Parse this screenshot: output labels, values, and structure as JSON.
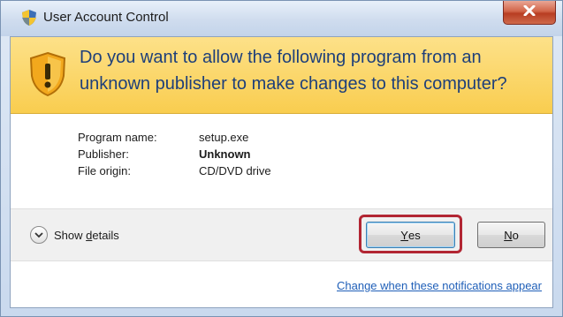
{
  "window": {
    "title": "User Account Control",
    "icon": "uac-shield-icon",
    "close_icon": "close-icon"
  },
  "banner": {
    "icon": "warning-shield-icon",
    "headline": "Do you want to allow the following program from an unknown publisher to make changes to this computer?"
  },
  "details": [
    {
      "label": "Program name:",
      "value": "setup.exe",
      "bold": false
    },
    {
      "label": "Publisher:",
      "value": "Unknown",
      "bold": true
    },
    {
      "label": "File origin:",
      "value": "CD/DVD drive",
      "bold": false
    }
  ],
  "actions": {
    "show_details_prefix": "Show ",
    "show_details_mnemonic": "d",
    "show_details_suffix": "etails",
    "yes_mnemonic": "Y",
    "yes_rest": "es",
    "no_mnemonic": "N",
    "no_rest": "o"
  },
  "footer": {
    "link": "Change when these notifications appear"
  },
  "colors": {
    "banner": "#f9cd4f",
    "headline": "#1e3f7a",
    "highlight": "#b22633",
    "link": "#1f5fb8"
  }
}
